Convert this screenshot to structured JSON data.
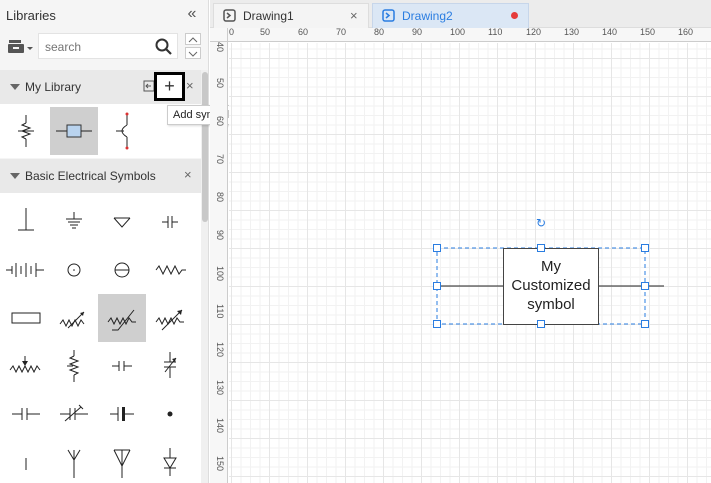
{
  "libraries": {
    "title": "Libraries",
    "search": {
      "placeholder": "search",
      "value": ""
    }
  },
  "my_library": {
    "label": "My Library",
    "tooltip": "Add symbols from the canvas",
    "symbols": [
      "variable-resistor-symbol",
      "customized-symbol",
      "switch-symbol"
    ]
  },
  "basic_electrical": {
    "label": "Basic Electrical Symbols",
    "symbols": [
      "ground-symbol",
      "chassis-ground-symbol",
      "signal-ground-symbol",
      "capacitor-symbol",
      "battery-symbol",
      "ac-source-symbol",
      "dc-source-symbol",
      "resistor-symbol",
      "fuse-symbol",
      "photoresistor-symbol",
      "varistor-symbol",
      "adjustable-resistor-symbol",
      "potentiometer-symbol",
      "tapped-resistor-symbol",
      "polarized-capacitor-symbol",
      "variable-capacitor-symbol",
      "nonpolarized-capacitor-symbol",
      "trimmer-capacitor-symbol",
      "electrolytic-capacitor-symbol",
      "junction-dot-symbol",
      "terminal-symbol",
      "antenna-symbol",
      "dipole-antenna-symbol",
      "diode-symbol"
    ]
  },
  "tabs": [
    {
      "label": "Drawing1",
      "active": false,
      "modified": false
    },
    {
      "label": "Drawing2",
      "active": true,
      "modified": true
    }
  ],
  "ruler": {
    "horizontal": [
      "0",
      "50",
      "60",
      "70",
      "80",
      "90",
      "100",
      "110",
      "120",
      "130",
      "140",
      "150",
      "160"
    ],
    "vertical": [
      "40",
      "50",
      "60",
      "70",
      "80",
      "90",
      "100",
      "110",
      "120",
      "130",
      "140",
      "150"
    ]
  },
  "canvas": {
    "symbol_text": "My\nCustomized\nsymbol"
  },
  "colors": {
    "accent": "#2a7de1",
    "modified_dot": "#e53b3b",
    "selected_symbol_bg": "#cfcfcf"
  }
}
